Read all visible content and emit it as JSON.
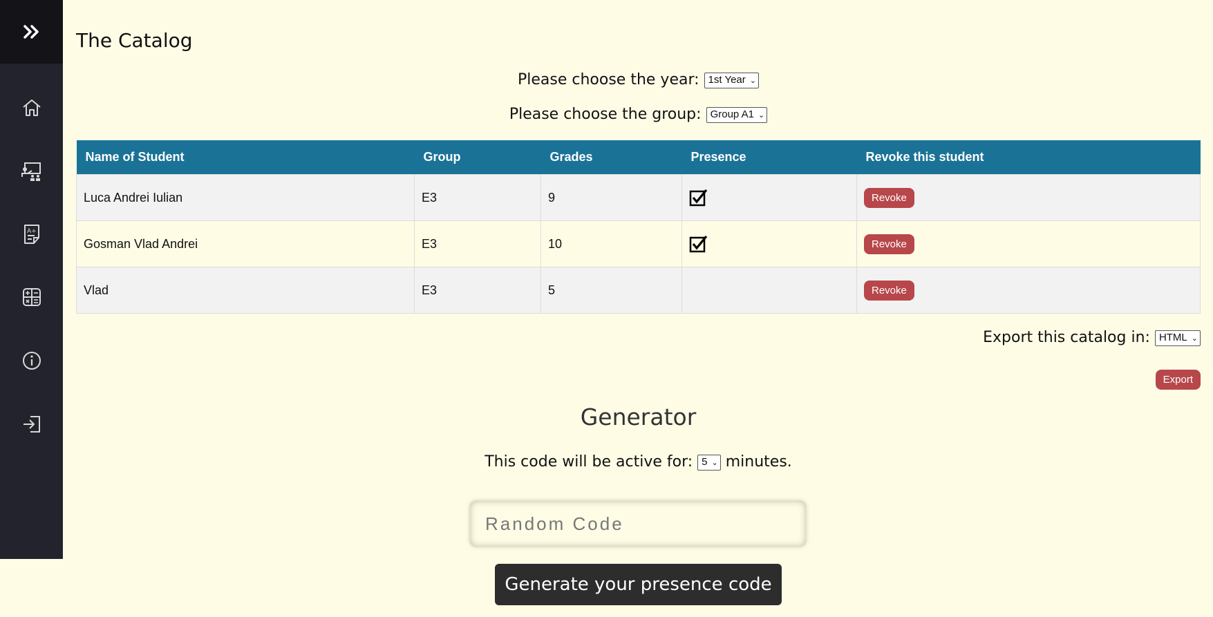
{
  "sidebar": {
    "toggle_icon": "double-chevron-right-icon",
    "items": [
      {
        "icon": "home-icon"
      },
      {
        "icon": "teacher-class-icon"
      },
      {
        "icon": "grade-sheet-icon"
      },
      {
        "icon": "calculator-icon"
      },
      {
        "icon": "info-icon"
      },
      {
        "icon": "logout-icon"
      }
    ]
  },
  "page_title": "The Catalog",
  "year_chooser": {
    "label": "Please choose the year:",
    "value": "1st Year"
  },
  "group_chooser": {
    "label": "Please choose the group:",
    "value": "Group A1"
  },
  "table": {
    "headers": [
      "Name of Student",
      "Group",
      "Grades",
      "Presence",
      "Revoke this student"
    ],
    "rows": [
      {
        "name": "Luca Andrei Iulian",
        "group": "E3",
        "grade": "9",
        "present": true,
        "action": "Revoke"
      },
      {
        "name": "Gosman Vlad Andrei",
        "group": "E3",
        "grade": "10",
        "present": true,
        "action": "Revoke"
      },
      {
        "name": "Vlad",
        "group": "E3",
        "grade": "5",
        "present": false,
        "action": "Revoke"
      }
    ]
  },
  "export": {
    "label": "Export this catalog in:",
    "format": "HTML",
    "button": "Export"
  },
  "generator": {
    "title": "Generator",
    "active_prefix": "This code will be active for:",
    "minutes_value": "5",
    "active_suffix": "minutes.",
    "code_placeholder": "Random Code",
    "generate_button": "Generate your presence code"
  },
  "colors": {
    "background": "#fffce6",
    "sidebar": "#23232d",
    "table_header": "#1a7396",
    "revoke_button": "#b7474a",
    "generate_button": "#2d2d2d"
  }
}
